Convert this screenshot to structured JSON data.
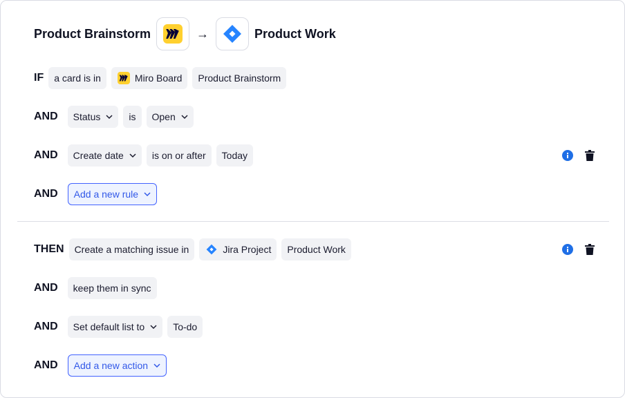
{
  "header": {
    "source_title": "Product Brainstorm",
    "arrow": "→",
    "target_title": "Product Work",
    "source_icon": "miro-logo-icon",
    "target_icon": "jira-logo-icon"
  },
  "colors": {
    "miro_yellow": "#FFD02F",
    "jira_blue": "#2684FF",
    "accent_blue": "#4262FF",
    "info_blue": "#1F6FE6"
  },
  "conditions": {
    "if_keyword": "IF",
    "and_keyword": "AND",
    "row1": {
      "a_card_is_in": "a card is in",
      "board_type": "Miro Board",
      "board_name": "Product Brainstorm"
    },
    "row2": {
      "field": "Status",
      "operator": "is",
      "value": "Open"
    },
    "row3": {
      "field": "Create date",
      "operator": "is on or after",
      "value": "Today"
    },
    "add_rule": "Add a new rule"
  },
  "actions": {
    "then_keyword": "THEN",
    "and_keyword": "AND",
    "row1": {
      "create": "Create a matching issue in",
      "project_type": "Jira Project",
      "project_name": "Product Work"
    },
    "row2": {
      "sync": "keep them in sync"
    },
    "row3": {
      "field": "Set default list to",
      "value": "To-do"
    },
    "add_action": "Add a new action"
  }
}
